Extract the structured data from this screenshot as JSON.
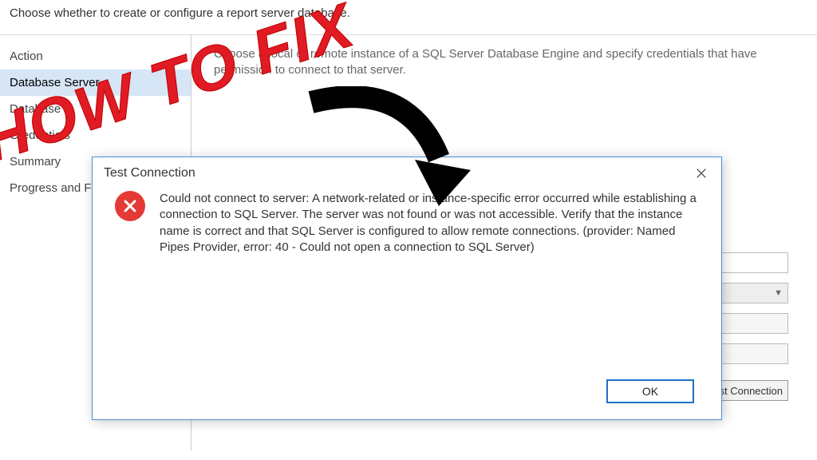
{
  "header": {
    "subtitle": "Choose whether to create or configure a report server database."
  },
  "sidebar": {
    "items": [
      {
        "label": "Action"
      },
      {
        "label": "Database Server"
      },
      {
        "label": "Database"
      },
      {
        "label": "Credentials"
      },
      {
        "label": "Summary"
      },
      {
        "label": "Progress and Finish"
      }
    ],
    "selected_index": 1
  },
  "content": {
    "description": "Choose a local or remote instance of a SQL Server Database Engine and specify credentials that have permission to connect to that server."
  },
  "buttons": {
    "test_connection": "Test Connection"
  },
  "dialog": {
    "title": "Test Connection",
    "message": "Could not connect to server: A network-related or instance-specific error occurred while establishing a connection to SQL Server. The server was not found or was not accessible. Verify that the instance name is correct and that SQL Server is configured to allow remote connections. (provider: Named Pipes Provider, error: 40 - Could not open a connection to SQL Server)",
    "ok_label": "OK"
  },
  "annotation": {
    "text": "HOW TO FIX"
  }
}
